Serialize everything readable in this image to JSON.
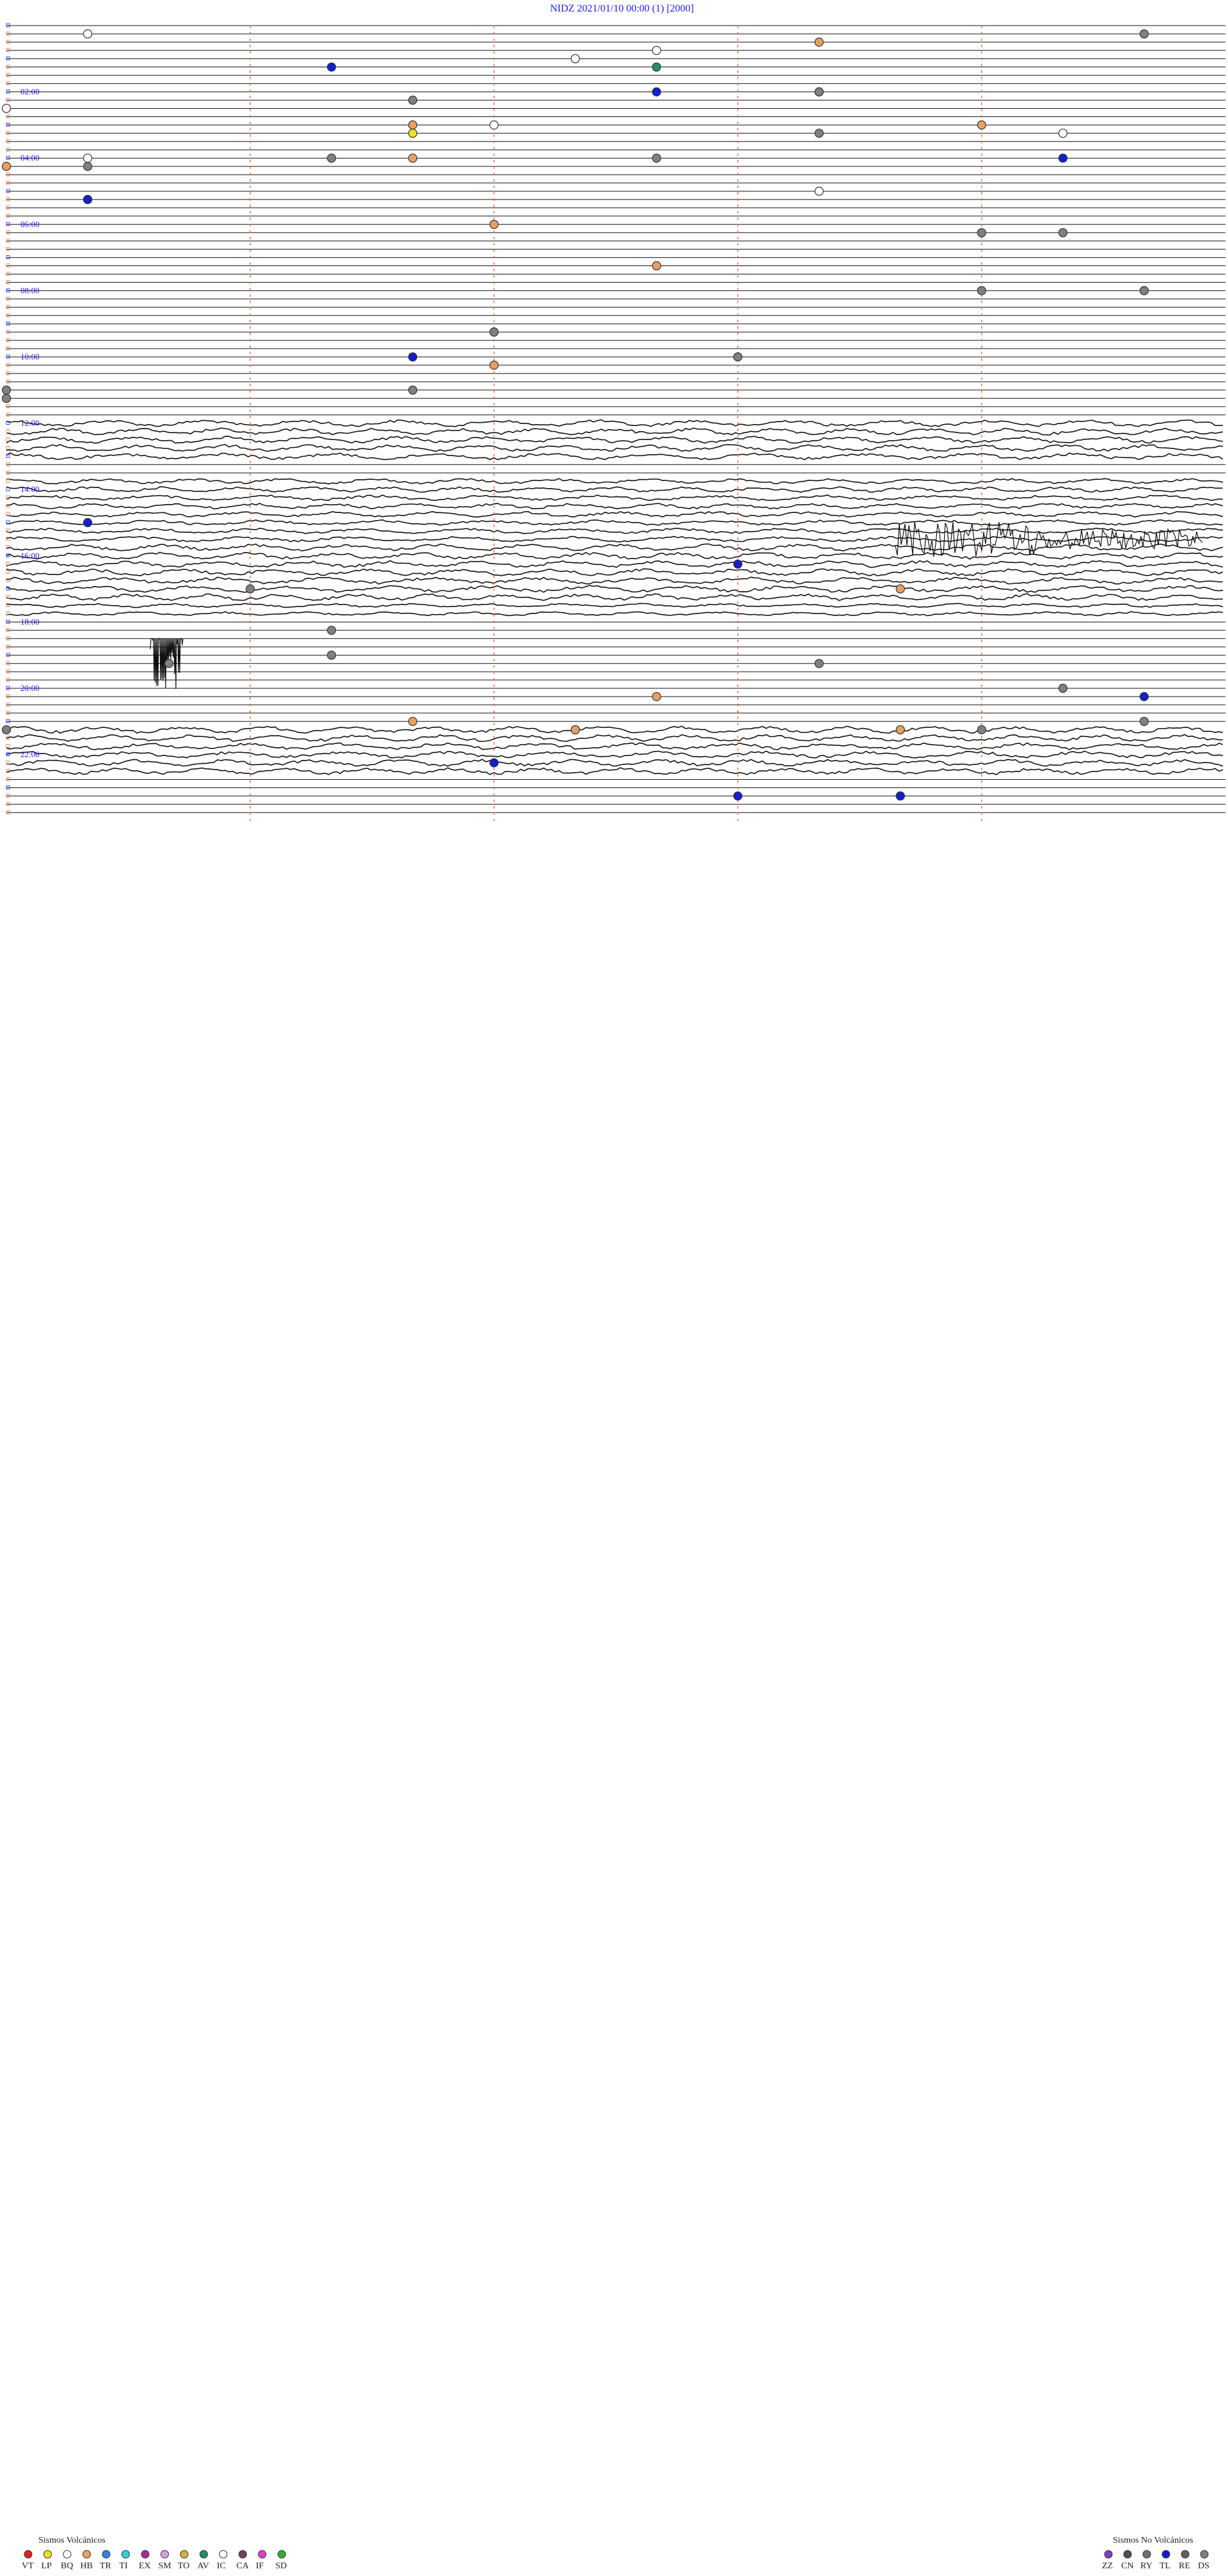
{
  "header": {
    "station": "NIDZ",
    "datetime": "2021/01/10 00:00",
    "channel": "(1)",
    "scale": "[2000]"
  },
  "chart_data": {
    "type": "scatter",
    "title": "NIDZ    2021/01/10 00:00      (1)    [2000]",
    "x": {
      "unit": "minutes",
      "range": [
        0,
        30
      ],
      "marker_minutes": [
        6,
        12,
        18,
        24
      ]
    },
    "rows_per_hour": 4,
    "hours": 24,
    "time_labels": [
      "02:00",
      "04:00",
      "06:00",
      "08:00",
      "10:00",
      "12:00",
      "14:00",
      "16:00",
      "18:00",
      "20:00",
      "22:00"
    ],
    "events": [
      {
        "time": "00:16",
        "type": "IC"
      },
      {
        "time": "00:29",
        "type": "DS"
      },
      {
        "time": "00:40",
        "type": "HB"
      },
      {
        "time": "00:53",
        "type": "IC"
      },
      {
        "time": "01:23",
        "type": "AV"
      },
      {
        "time": "01:07",
        "type": "IC"
      },
      {
        "time": "01:19",
        "type": "TL"
      },
      {
        "time": "02:10",
        "type": "HB"
      },
      {
        "time": "02:10",
        "type": "DS"
      },
      {
        "time": "02:20",
        "type": "DS"
      },
      {
        "time": "02:30",
        "type": "IC"
      },
      {
        "time": "02:08",
        "type": "TL"
      },
      {
        "time": "03:06",
        "type": "IC"
      },
      {
        "time": "03:28",
        "type": "IC"
      },
      {
        "time": "03:12",
        "type": "HB"
      },
      {
        "time": "03:05",
        "type": "HB"
      },
      {
        "time": "03:20",
        "type": "LP"
      },
      {
        "time": "03:25",
        "type": "DS"
      },
      {
        "time": "04:01",
        "type": "IC"
      },
      {
        "time": "04:04",
        "type": "DS"
      },
      {
        "time": "04:08",
        "type": "DS"
      },
      {
        "time": "04:13",
        "type": "TL"
      },
      {
        "time": "04:16",
        "type": "DS"
      },
      {
        "time": "04:15",
        "type": "HB"
      },
      {
        "time": "04:05",
        "type": "HB"
      },
      {
        "time": "05:16",
        "type": "DS"
      },
      {
        "time": "05:16",
        "type": "TL"
      },
      {
        "time": "05:10",
        "type": "IC"
      },
      {
        "time": "06:06",
        "type": "HB"
      },
      {
        "time": "06:27",
        "type": "DS"
      },
      {
        "time": "06:28",
        "type": "DS"
      },
      {
        "time": "07:23",
        "type": "HB"
      },
      {
        "time": "08:12",
        "type": "DS"
      },
      {
        "time": "08:14",
        "type": "TL"
      },
      {
        "time": "08:14",
        "type": "DS"
      },
      {
        "time": "09:21",
        "type": "DS"
      },
      {
        "time": "09:21",
        "type": "DS"
      },
      {
        "time": "10:05",
        "type": "TL"
      },
      {
        "time": "10:09",
        "type": "DS"
      },
      {
        "time": "10:21",
        "type": "HB"
      },
      {
        "time": "11:00",
        "type": "DS"
      },
      {
        "time": "11:05",
        "type": "DS"
      },
      {
        "time": "11:15",
        "type": "DS"
      },
      {
        "time": "15:01",
        "type": "TL"
      },
      {
        "time": "16:24",
        "type": "TL"
      },
      {
        "time": "17:11",
        "type": "HB"
      },
      {
        "time": "17:03",
        "type": "DS"
      },
      {
        "time": "18:19",
        "type": "DS"
      },
      {
        "time": "19:04",
        "type": "DS"
      },
      {
        "time": "19:17",
        "type": "DS"
      },
      {
        "time": "19:25",
        "type": "DS"
      },
      {
        "time": "20:13",
        "type": "DS"
      },
      {
        "time": "20:23",
        "type": "HB"
      },
      {
        "time": "20:29",
        "type": "TL"
      },
      {
        "time": "21:22",
        "type": "DS"
      },
      {
        "time": "21:27",
        "type": "DS"
      },
      {
        "time": "21:26",
        "type": "HB"
      },
      {
        "time": "21:15",
        "type": "DS"
      },
      {
        "time": "21:22",
        "type": "HB"
      },
      {
        "time": "21:05",
        "type": "HB"
      },
      {
        "time": "21:14",
        "type": "DS"
      },
      {
        "time": "22:21",
        "type": "TL"
      },
      {
        "time": "23:24",
        "type": "TL"
      },
      {
        "time": "23:26",
        "type": "HB"
      },
      {
        "time": "23:26",
        "type": "TL"
      }
    ],
    "legend_volcanic": {
      "title": "Sismos Volcánicos",
      "codes": [
        "VT",
        "LP",
        "BQ",
        "HB",
        "TR",
        "TI",
        "EX",
        "SM",
        "TO",
        "AV",
        "IC",
        "CA",
        "IF",
        "SD"
      ],
      "colors": [
        "#e02020",
        "#f0e020",
        "#ffffff",
        "#e8a060",
        "#3080e0",
        "#30d0e0",
        "#a03090",
        "#d8a0e0",
        "#d0b040",
        "#209060",
        "#ffffff",
        "#704060",
        "#e040c0",
        "#30b030"
      ]
    },
    "legend_nonvolcanic": {
      "title": "Sismos No Volcánicos",
      "codes": [
        "ZZ",
        "CN",
        "RY",
        "TL",
        "RE",
        "DS"
      ],
      "colors": [
        "#8040c0",
        "#505050",
        "#707070",
        "#1020d0",
        "#606060",
        "#808080"
      ]
    }
  }
}
